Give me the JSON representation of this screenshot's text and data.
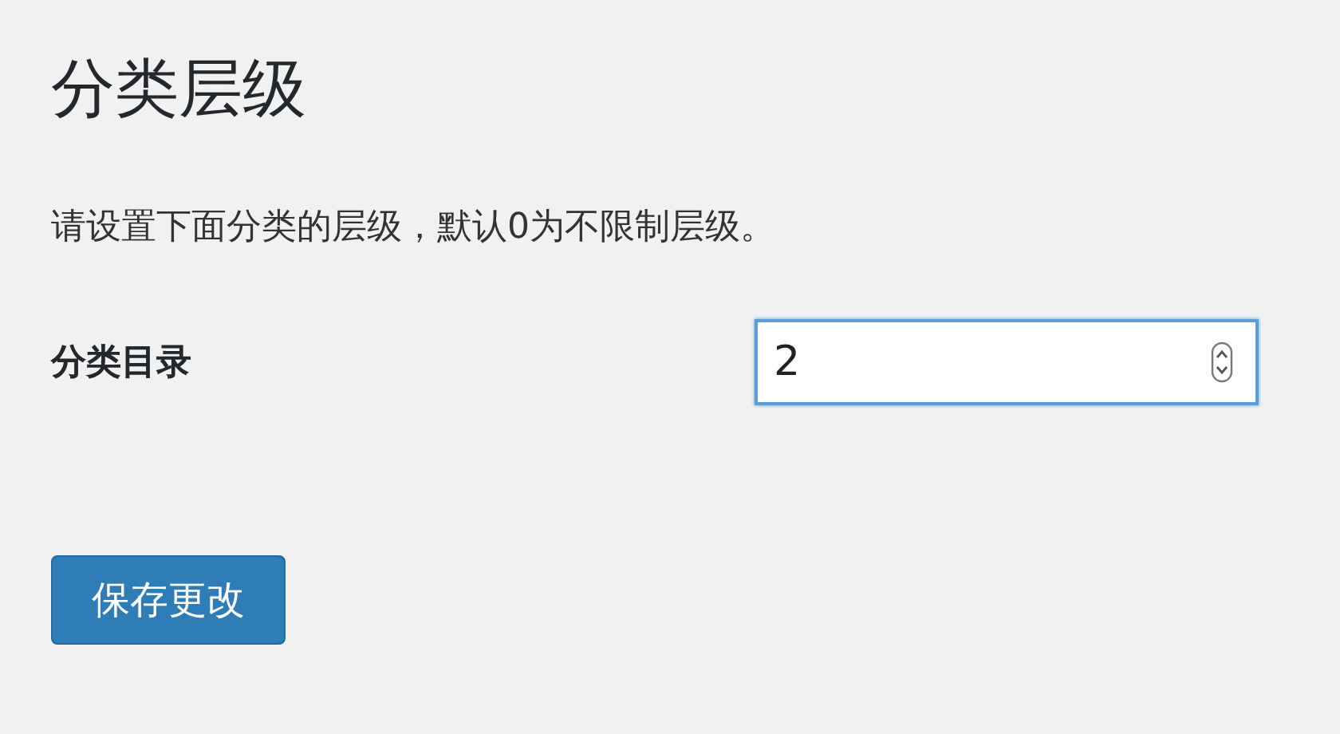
{
  "title": "分类层级",
  "description": "请设置下面分类的层级，默认0为不限制层级。",
  "setting": {
    "label": "分类目录",
    "value": "2",
    "focused": true
  },
  "save_button": "保存更改"
}
